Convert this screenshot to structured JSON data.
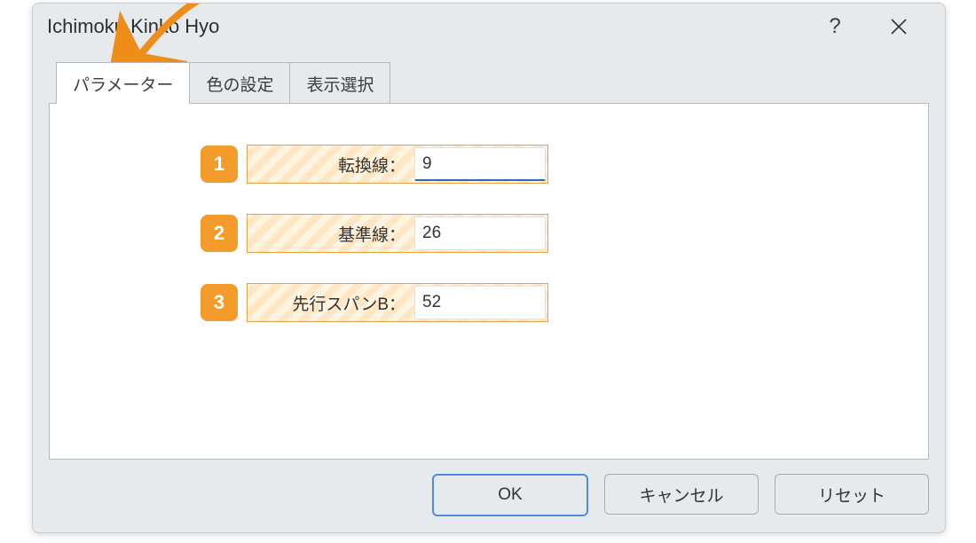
{
  "window": {
    "title": "Ichimoku Kinko Hyo"
  },
  "tabs": [
    {
      "label": "パラメーター",
      "active": true
    },
    {
      "label": "色の設定",
      "active": false
    },
    {
      "label": "表示選択",
      "active": false
    }
  ],
  "params": [
    {
      "badge": "1",
      "label": "転換線：",
      "value": "9",
      "focused": true
    },
    {
      "badge": "2",
      "label": "基準線：",
      "value": "26",
      "focused": false
    },
    {
      "badge": "3",
      "label": "先行スパンB：",
      "value": "52",
      "focused": false
    }
  ],
  "buttons": {
    "ok": "OK",
    "cancel": "キャンセル",
    "reset": "リセット"
  },
  "titlebar": {
    "help": "?",
    "close": "×"
  }
}
